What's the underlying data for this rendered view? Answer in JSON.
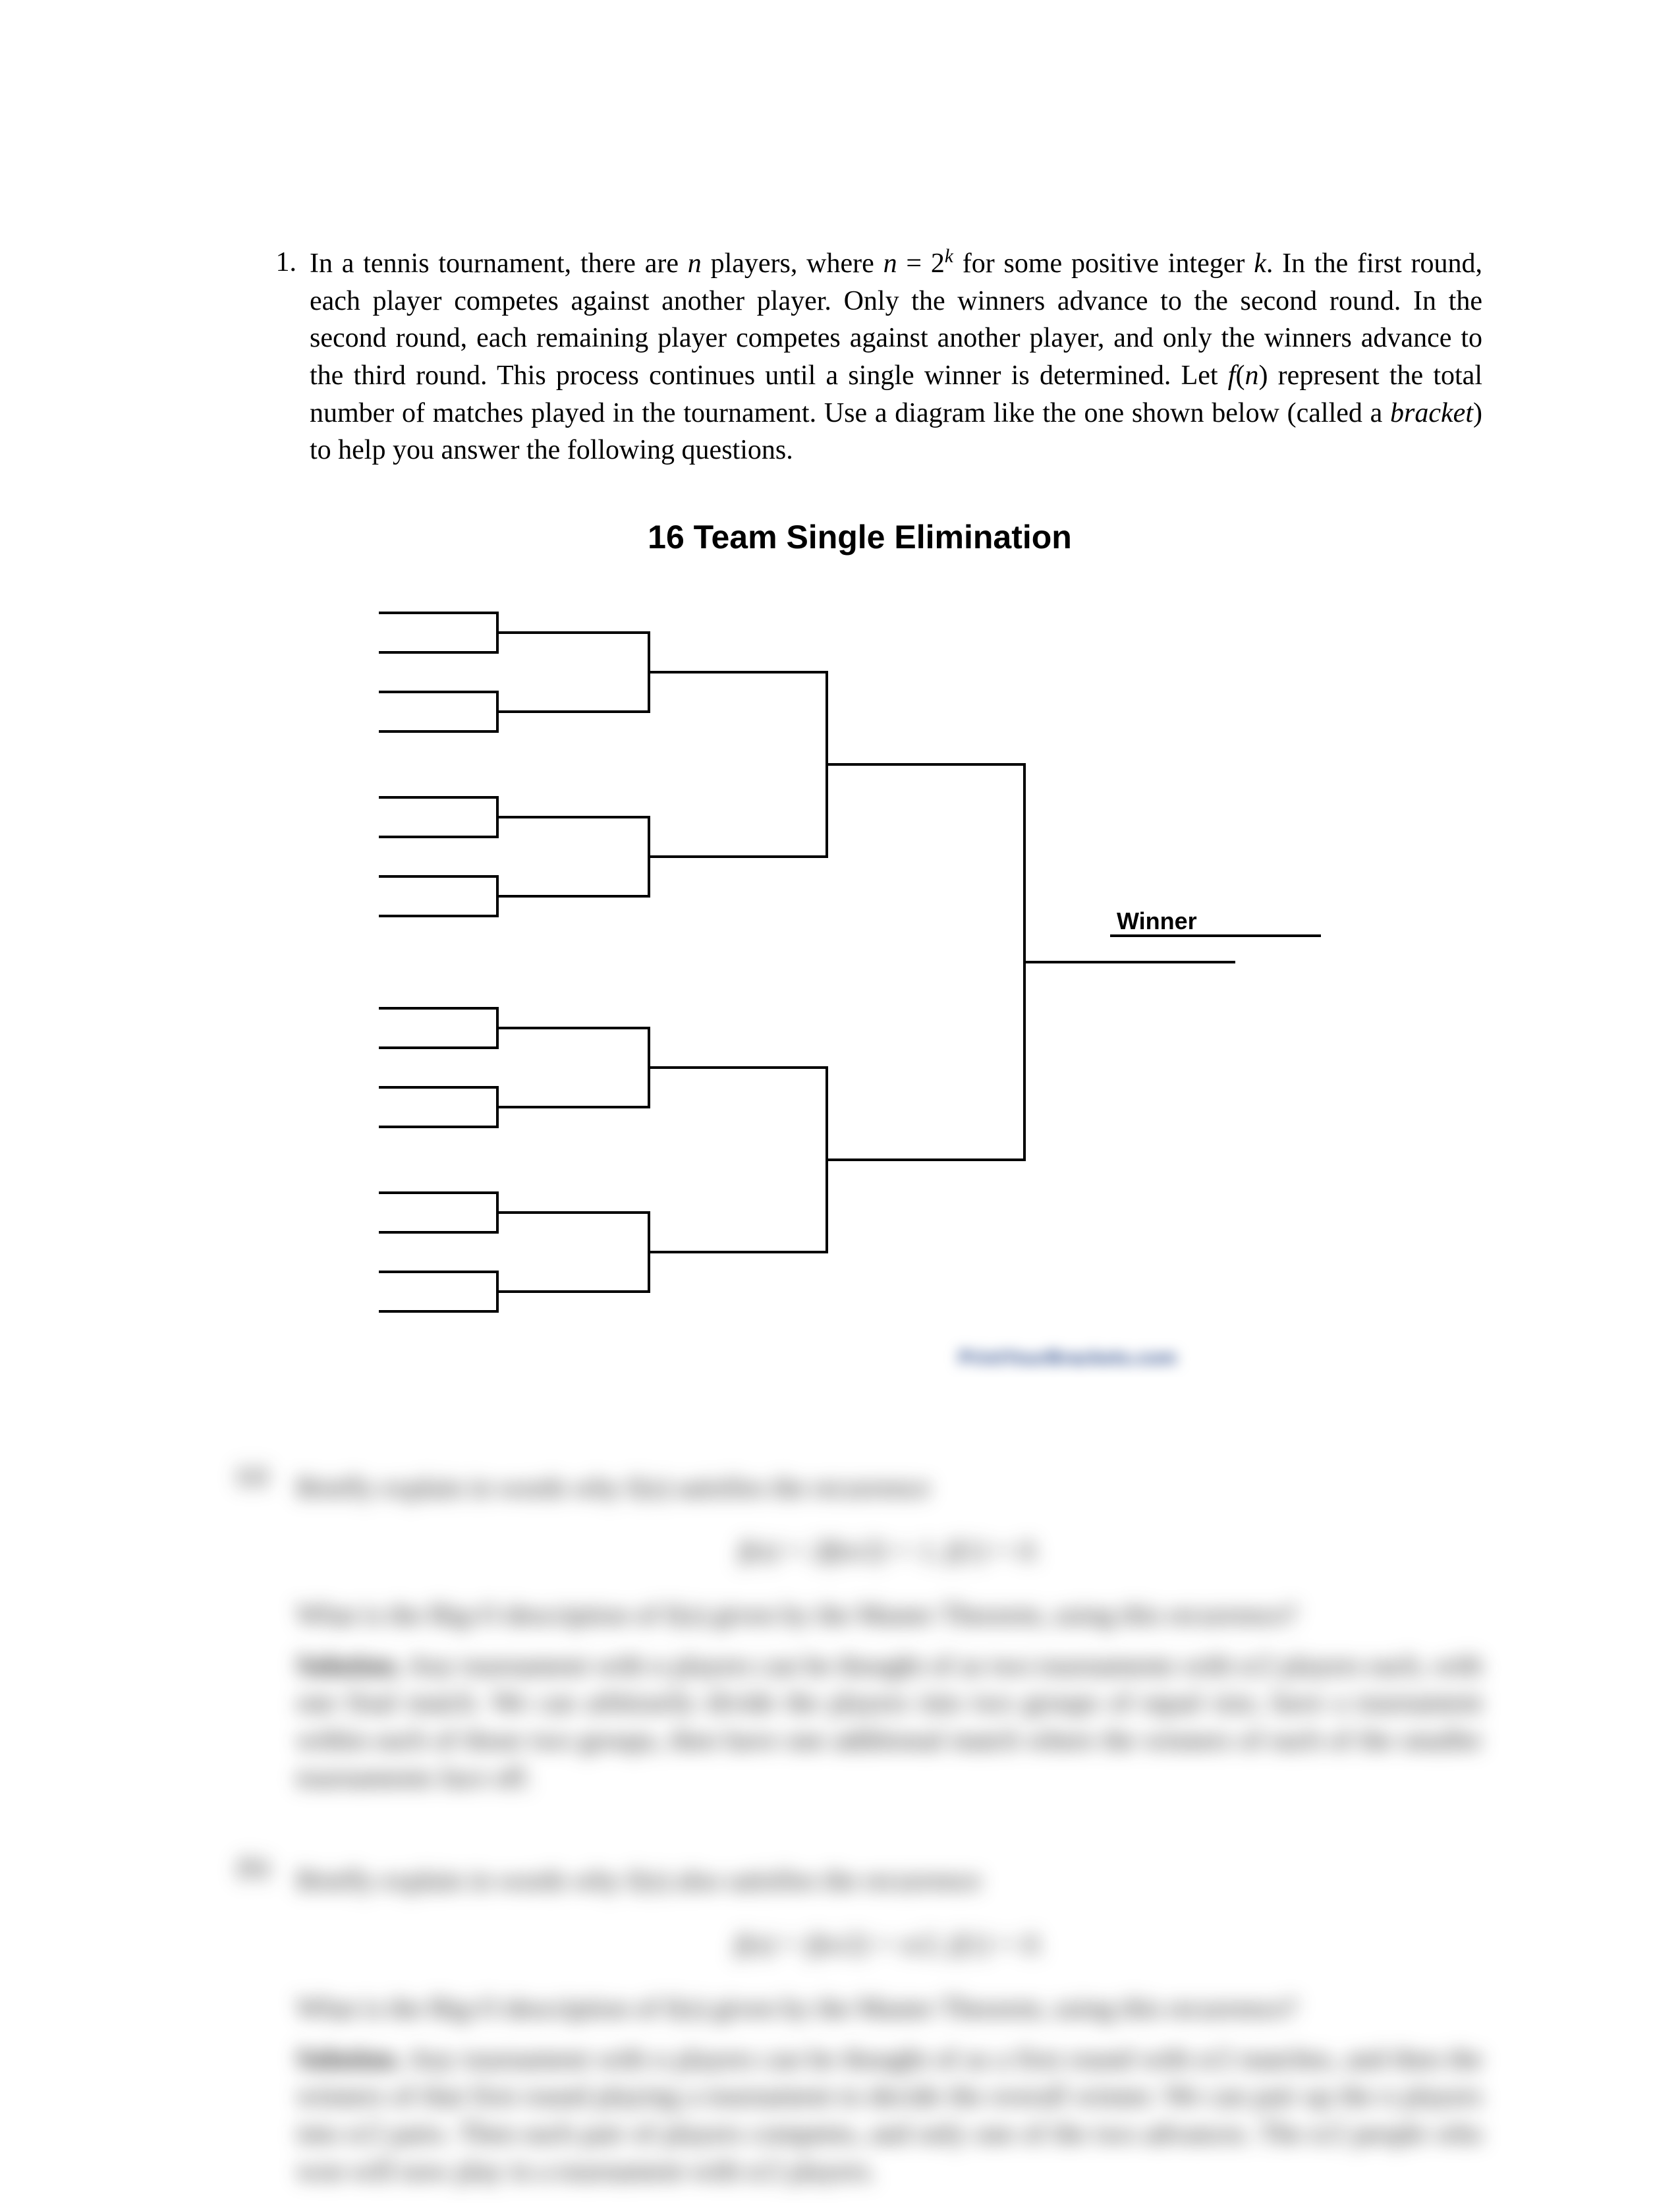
{
  "problem": {
    "number": "1.",
    "text_parts": {
      "p1": "In a tennis tournament, there are ",
      "var_n": "n",
      "p2": " players, where ",
      "eq1_lhs": "n",
      "eq1_eq": " = 2",
      "eq1_exp": "k",
      "p3": " for some positive integer ",
      "var_k": "k",
      "p4": ".  In the first round, each player competes against another player.  Only the winners advance to the second round.  In the second round, each remaining player competes against another player, and only the winners advance to the third round.  This process continues until a single winner is determined.  Let ",
      "fn": "f",
      "fn_arg_open": "(",
      "fn_arg": "n",
      "fn_arg_close": ")",
      "p5": " represent the total number of matches played in the tournament.  Use a diagram like the one shown below (called a ",
      "bracket_word": "bracket",
      "p6": ") to help you answer the following questions."
    }
  },
  "bracket": {
    "title": "16 Team Single Elimination",
    "winner": "Winner",
    "attribution": "PrintYourBrackets.com"
  },
  "blurred": {
    "a_label": "(a)",
    "a_text": "Briefly explain in words why f(n) satisfies the recurrence",
    "a_eq": "f(n) = 2f(n/2) + 1,        f(1) = 0.",
    "a_q": "What is the Big-O description of f(n) given by the Master Theorem, using this recurrence?",
    "a_sol_label": "Solution.",
    "a_sol": "Any tournament with n players can be thought of as two tournaments with n/2 players each, with one final match. We can arbitrarily divide the players into two groups of equal size, have a tournament within each of those two groups, then have one additional match where the winners of each of the smaller tournaments face off.",
    "b_label": "(b)",
    "b_text": "Briefly explain in words why f(n) also satisfies the recurrence",
    "b_eq": "f(n) = f(n/2) + n/2,        f(1) = 0.",
    "b_q": "What is the Big-O description of f(n) given by the Master Theorem, using this recurrence?",
    "b_sol_label": "Solution.",
    "b_sol": "Any tournament with n players can be thought of as a first round with n/2 matches, and then the winners of that first round playing a tournament to decide the overall winner. We can pair up the n players into n/2 pairs. Then each pair of players competes, and only one of the two advances. The n/2 people who won will now play in a tournament with n/2 players."
  }
}
